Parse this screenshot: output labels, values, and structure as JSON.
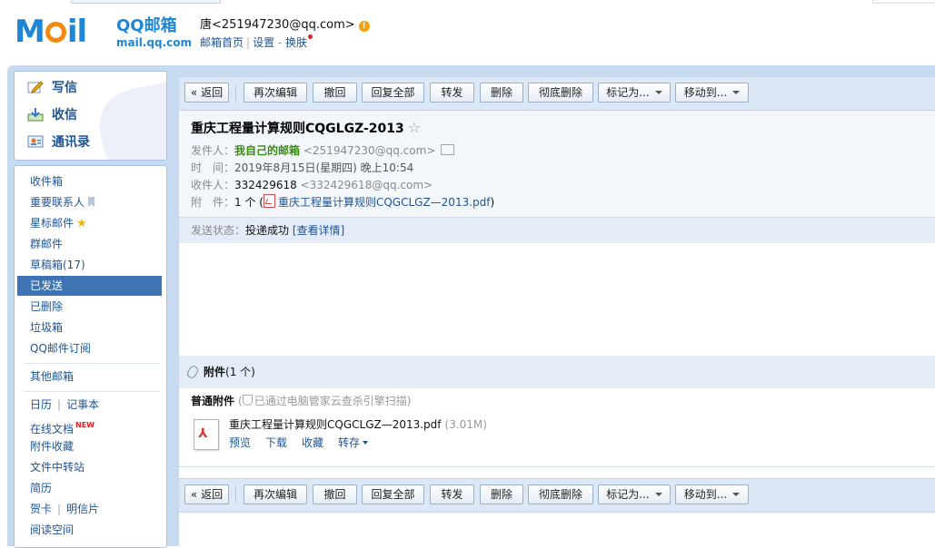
{
  "logo": {
    "word": "M",
    "word_tail": "il",
    "cn": "QQ邮箱",
    "url": "mail.qq.com"
  },
  "user": {
    "name_email": "唐<251947230@qq.com>",
    "warn_icon": "!"
  },
  "top_links": {
    "home": "邮箱首页",
    "settings": "设置",
    "dash": " - ",
    "skin": "换肤",
    "sep": "|"
  },
  "quick": {
    "compose": "写信",
    "receive": "收信",
    "contacts": "通讯录"
  },
  "nav": {
    "inbox": "收件箱",
    "vip": "重要联系人",
    "starred": "星标邮件",
    "group": "群邮件",
    "drafts": "草稿箱(17)",
    "sent": "已发送",
    "deleted": "已删除",
    "spam": "垃圾箱",
    "subscribe": "QQ邮件订阅",
    "other": "其他邮箱",
    "calendar": "日历",
    "notes": "记事本",
    "docs": "在线文档",
    "new_badge": "NEW",
    "att_fav": "附件收藏",
    "transfer": "文件中转站",
    "resume": "简历",
    "cards": "贺卡",
    "postcards": "明信片",
    "reading": "阅读空间",
    "pipe": "|"
  },
  "toolbar": {
    "back": "« 返回",
    "reedit": "再次编辑",
    "recall": "撤回",
    "reply_all": "回复全部",
    "forward": "转发",
    "delete": "删除",
    "delete_perm": "彻底删除",
    "mark_as": "标记为...",
    "move_to": "移动到..."
  },
  "mail": {
    "subject": "重庆工程量计算规则CQGLGZ-2013",
    "star": "☆",
    "from_label": "发件人：",
    "from_name": "我自己的邮箱",
    "from_email": "<251947230@qq.com>",
    "time_label": "时　间：",
    "time": "2019年8月15日(星期四) 晚上10:54",
    "to_label": "收件人：",
    "to_name": "332429618",
    "to_email": "<332429618@qq.com>",
    "att_label": "附　件：",
    "att_count": "1 个 (",
    "att_file": "重庆工程量计算规则CQGCLGZ—2013.pdf",
    "att_close": ")",
    "status_label": "发送状态：",
    "status_value": "投递成功",
    "status_detail": "[查看详情]"
  },
  "attachments": {
    "title": "附件",
    "count": "(1 个)",
    "kind": "普通附件",
    "scan_note": "已通过电脑管家云查杀引擎扫描",
    "file_name": "重庆工程量计算规则CQGCLGZ—2013.pdf",
    "file_size": "(3.01M)",
    "preview": "预览",
    "download": "下载",
    "favorite": "收藏",
    "save_to": "转存"
  },
  "colors": {
    "brand_blue": "#1f86d6",
    "logo_orange": "#f08a12",
    "active_nav": "#3e74b3",
    "frame_blue": "#c8daf0"
  }
}
